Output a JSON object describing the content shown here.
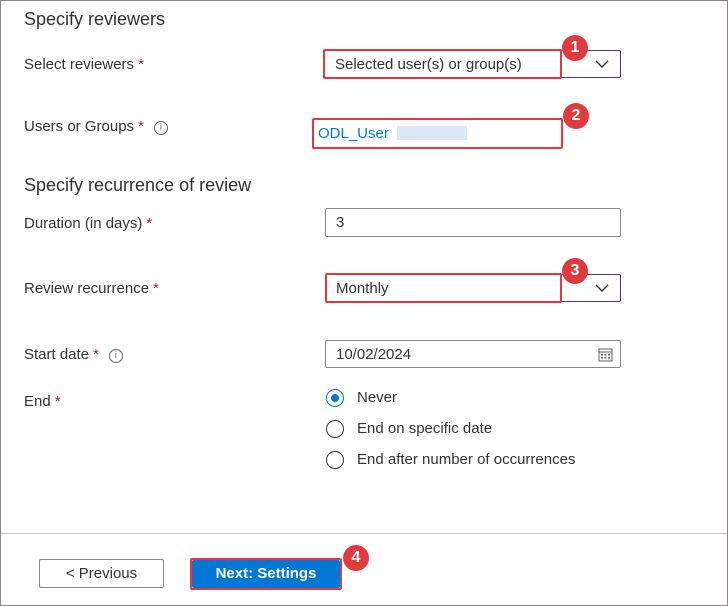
{
  "reviewers": {
    "title": "Specify reviewers",
    "select_label": "Select reviewers",
    "select_value": "Selected user(s) or group(s)",
    "users_label": "Users or Groups",
    "users_value": "ODL_User"
  },
  "recurrence": {
    "title": "Specify recurrence of review",
    "duration_label": "Duration (in days)",
    "duration_value": "3",
    "recurrence_label": "Review recurrence",
    "recurrence_value": "Monthly",
    "start_label": "Start date",
    "start_value": "10/02/2024",
    "end_label": "End",
    "end_options": [
      "Never",
      "End on specific date",
      "End after number of occurrences"
    ],
    "end_selected": "Never"
  },
  "required_marker": "*",
  "info_glyph": "i",
  "footer": {
    "previous_label": "< Previous",
    "next_label": "Next: Settings"
  },
  "callouts": [
    "1",
    "2",
    "3",
    "4"
  ],
  "colors": {
    "accent": "#0078d4",
    "required": "#a4262c",
    "callout": "#e0393e"
  }
}
